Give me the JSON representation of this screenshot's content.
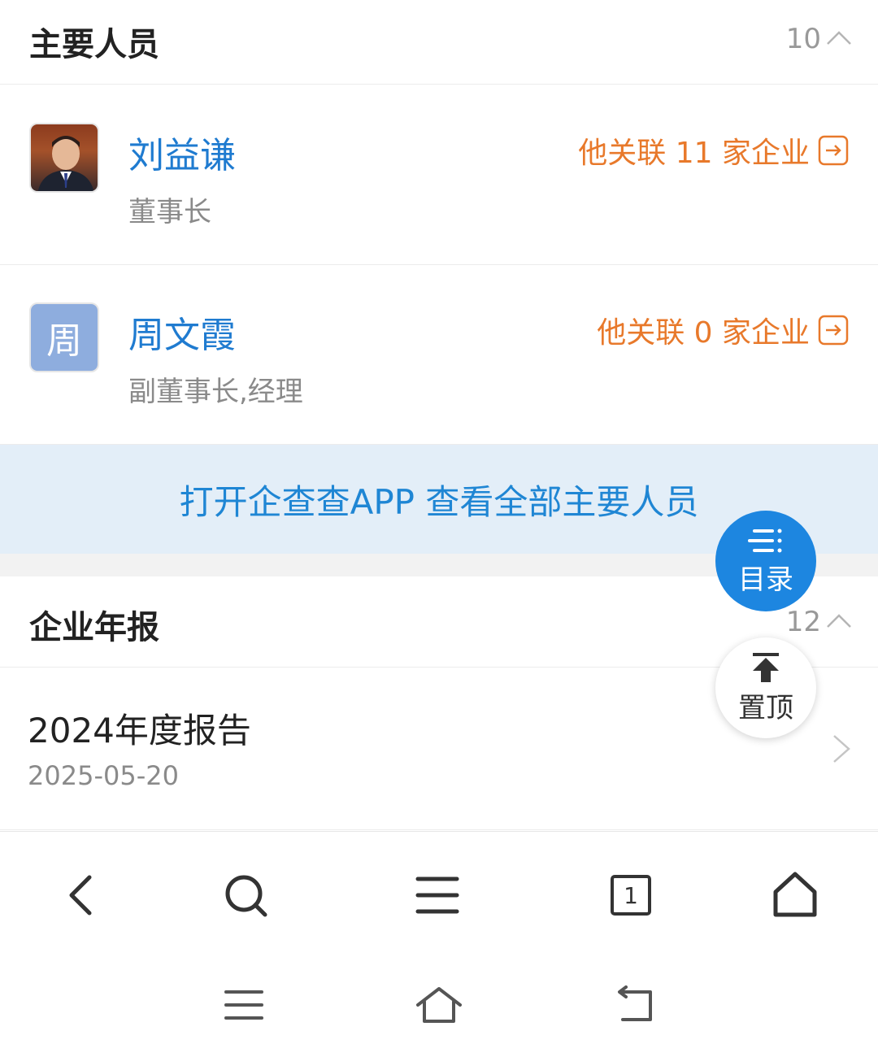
{
  "main_personnel": {
    "title": "主要人员",
    "count": "10",
    "people": [
      {
        "name": "刘益谦",
        "role": "董事长",
        "related": "他关联 11 家企业",
        "avatar": "photo"
      },
      {
        "name": "周文霞",
        "role": "副董事长,经理",
        "related": "他关联 0 家企业",
        "avatar_letter": "周"
      }
    ],
    "banner": "打开企查查APP 查看全部主要人员"
  },
  "annual_reports": {
    "title": "企业年报",
    "count": "12",
    "items": [
      {
        "title": "2024年度报告",
        "date": "2025-05-20"
      }
    ]
  },
  "floating": {
    "toc_label": "目录",
    "top_label": "置顶"
  },
  "browser_nav": {
    "tab_count": "1",
    "icons": [
      "back-icon",
      "search-icon",
      "menu-icon",
      "tabs-icon",
      "home-icon"
    ]
  },
  "system_nav": {
    "icons": [
      "recent-apps-icon",
      "home-icon",
      "back-icon"
    ]
  },
  "colors": {
    "link_blue": "#1f7bd0",
    "accent_orange": "#e8792b",
    "fab_blue": "#1d86e0",
    "banner_bg": "#e3eef8"
  }
}
